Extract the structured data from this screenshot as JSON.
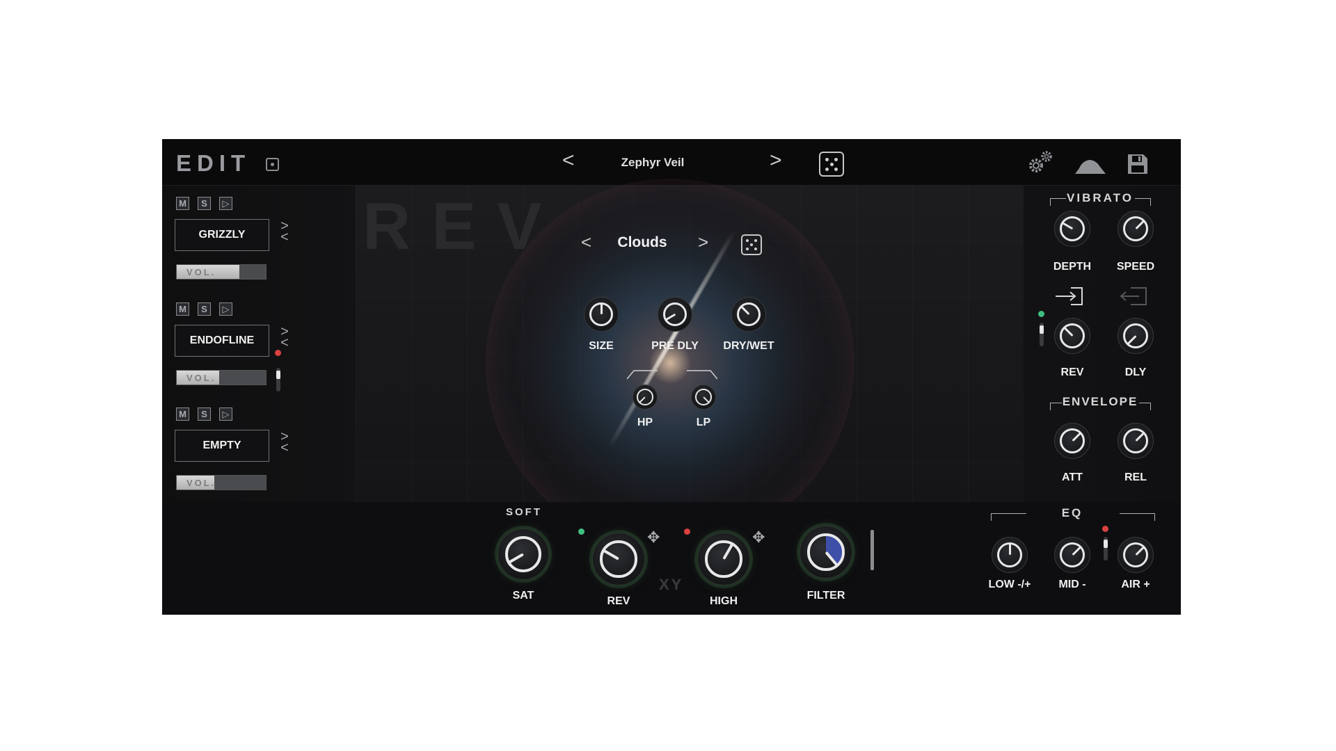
{
  "header": {
    "title": "EDIT",
    "preset_prev": "<",
    "preset_name": "Zephyr Veil",
    "preset_next": ">",
    "dice_icon": "dice-icon",
    "settings_icon": "gears-icon",
    "envelope_icon": "mountain-icon",
    "save_icon": "floppy-disk-icon"
  },
  "tracks": [
    {
      "mute": "M",
      "solo": "S",
      "play": "▷",
      "name": "GRIZZLY",
      "vol_label": "VOL.",
      "vol_level": 0.7
    },
    {
      "mute": "M",
      "solo": "S",
      "play": "▷",
      "name": "ENDOFLINE",
      "vol_label": "VOL.",
      "vol_level": 0.48
    },
    {
      "mute": "M",
      "solo": "S",
      "play": "▷",
      "name": "EMPTY",
      "vol_label": "VOL.",
      "vol_level": 0.42
    }
  ],
  "reverb": {
    "background_word": "REV",
    "prev": "<",
    "type": "Clouds",
    "next": ">",
    "knobs": {
      "size": "SIZE",
      "pre_dly": "PRE DLY",
      "dry_wet": "DRY/WET",
      "hp": "HP",
      "lp": "LP"
    }
  },
  "vibrato": {
    "title": "VIBRATO",
    "depth": "DEPTH",
    "speed": "SPEED",
    "rev": "REV",
    "dly": "DLY"
  },
  "envelope": {
    "title": "ENVELOPE",
    "att": "ATT",
    "rel": "REL"
  },
  "bottom": {
    "soft": "SOFT",
    "sat": "SAT",
    "rev": "REV",
    "xy": "XY",
    "high": "HIGH",
    "filter": "FILTER"
  },
  "eq": {
    "title": "EQ",
    "low": "LOW -/+",
    "mid": "MID -",
    "air": "AIR +"
  },
  "colors": {
    "green_dot": "#3fbf7f",
    "red_dot": "#d9423f",
    "filter_accent": "#3e4fa8"
  }
}
